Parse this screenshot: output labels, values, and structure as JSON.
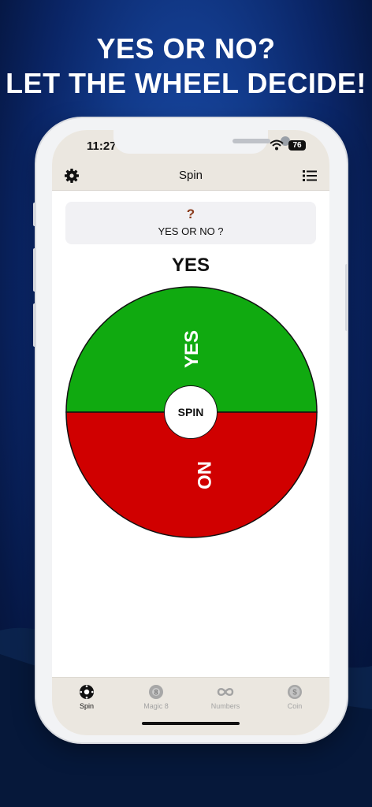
{
  "headline": {
    "line1": "YES OR NO?",
    "line2": "LET THE WHEEL DECIDE!"
  },
  "status_bar": {
    "time": "11:27",
    "battery": "76"
  },
  "nav": {
    "title": "Spin",
    "left_icon": "gear-icon",
    "right_icon": "list-icon"
  },
  "question": {
    "icon": "?",
    "text": "YES OR NO ?"
  },
  "result": "YES",
  "wheel": {
    "segments": [
      {
        "label": "YES",
        "color": "#10aa10"
      },
      {
        "label": "NO",
        "color": "#d00000"
      }
    ],
    "spin_label": "SPIN"
  },
  "tabs": [
    {
      "label": "Spin",
      "icon": "spin-wheel-icon",
      "active": true
    },
    {
      "label": "Magic 8",
      "icon": "magic-8-icon",
      "active": false
    },
    {
      "label": "Numbers",
      "icon": "infinity-icon",
      "active": false
    },
    {
      "label": "Coin",
      "icon": "coin-icon",
      "active": false
    }
  ],
  "colors": {
    "background": "#0b2a6e",
    "bar": "#ebe7e0",
    "yes": "#10aa10",
    "no": "#d00000"
  }
}
